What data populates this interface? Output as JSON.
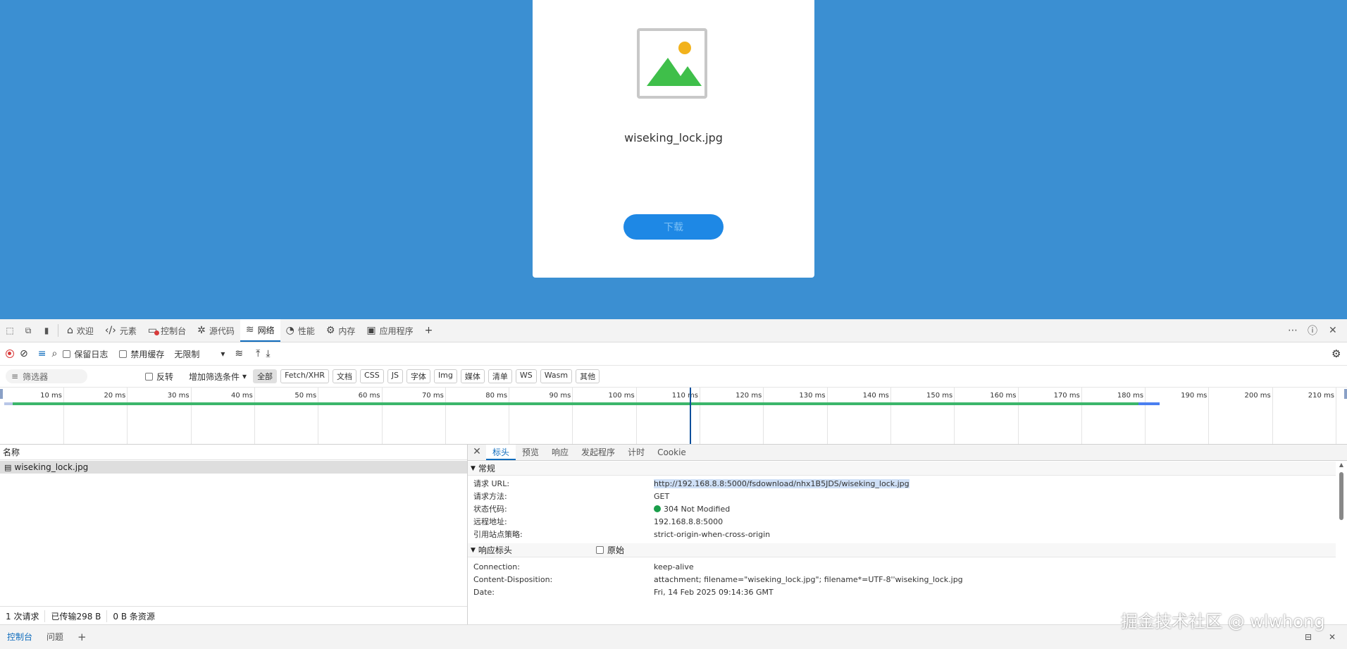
{
  "page": {
    "file_name": "wiseking_lock.jpg",
    "download_label": "下载"
  },
  "devtools": {
    "tabs": [
      {
        "label": "欢迎",
        "icon": "home-icon"
      },
      {
        "label": "元素",
        "icon": "code-icon"
      },
      {
        "label": "控制台",
        "icon": "console-icon"
      },
      {
        "label": "源代码",
        "icon": "bug-icon"
      },
      {
        "label": "网络",
        "icon": "wifi-icon",
        "active": true
      },
      {
        "label": "性能",
        "icon": "gauge-icon"
      },
      {
        "label": "内存",
        "icon": "memory-icon"
      },
      {
        "label": "应用程序",
        "icon": "app-icon"
      }
    ],
    "toolbar": {
      "preserve_log": "保留日志",
      "disable_cache": "禁用缓存",
      "throttle": "无限制"
    },
    "filter": {
      "placeholder": "筛选器",
      "invert": "反转",
      "more_filters": "增加筛选条件",
      "chips": [
        "全部",
        "Fetch/XHR",
        "文档",
        "CSS",
        "JS",
        "字体",
        "Img",
        "媒体",
        "清单",
        "WS",
        "Wasm",
        "其他"
      ]
    },
    "timeline": {
      "ticks": [
        "10 ms",
        "20 ms",
        "30 ms",
        "40 ms",
        "50 ms",
        "60 ms",
        "70 ms",
        "80 ms",
        "90 ms",
        "100 ms",
        "110 ms",
        "120 ms",
        "130 ms",
        "140 ms",
        "150 ms",
        "160 ms",
        "170 ms",
        "180 ms",
        "190 ms",
        "200 ms",
        "210 ms"
      ]
    },
    "list": {
      "header": "名称",
      "rows": [
        "wiseking_lock.jpg"
      ]
    },
    "status": {
      "requests": "1 次请求",
      "transferred": "已传输298 B",
      "resources": "0 B 条资源"
    },
    "detail": {
      "tabs": [
        "标头",
        "预览",
        "响应",
        "发起程序",
        "计时",
        "Cookie"
      ],
      "general_title": "常规",
      "general": [
        {
          "k": "请求 URL:",
          "v": "http://192.168.8.8:5000/fsdownload/nhx1B5JDS/wiseking_lock.jpg"
        },
        {
          "k": "请求方法:",
          "v": "GET"
        },
        {
          "k": "状态代码:",
          "v": "304 Not Modified"
        },
        {
          "k": "远程地址:",
          "v": "192.168.8.8:5000"
        },
        {
          "k": "引用站点策略:",
          "v": "strict-origin-when-cross-origin"
        }
      ],
      "response_title": "响应标头",
      "raw_label": "原始",
      "response": [
        {
          "k": "Connection:",
          "v": "keep-alive"
        },
        {
          "k": "Content-Disposition:",
          "v": "attachment; filename=\"wiseking_lock.jpg\"; filename*=UTF-8''wiseking_lock.jpg"
        },
        {
          "k": "Date:",
          "v": "Fri, 14 Feb 2025 09:14:36 GMT"
        }
      ]
    },
    "bottom_tabs": [
      "控制台",
      "问题"
    ]
  },
  "watermark": "掘金技术社区 @ wlwhong"
}
